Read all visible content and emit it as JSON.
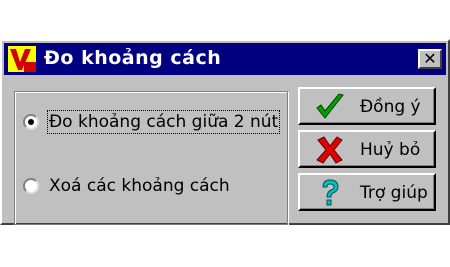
{
  "window": {
    "title": "Đo khoảng cách",
    "close_symbol": "✕"
  },
  "options": {
    "items": [
      {
        "label": "Đo khoảng cách giữa 2 nút",
        "selected": true
      },
      {
        "label": "Xoá các khoảng cách",
        "selected": false
      }
    ]
  },
  "buttons": {
    "ok": {
      "label": "Đồng ý",
      "icon": "checkmark-icon"
    },
    "cancel": {
      "label": "Huỷ bỏ",
      "icon": "x-mark-icon"
    },
    "help": {
      "label": "Trợ giúp",
      "icon": "question-mark-icon"
    }
  },
  "colors": {
    "titlebar": "#000080",
    "face": "#c0c0c0",
    "ok_icon": "#00a000",
    "cancel_icon": "#e00000",
    "help_icon": "#00c0c0"
  }
}
